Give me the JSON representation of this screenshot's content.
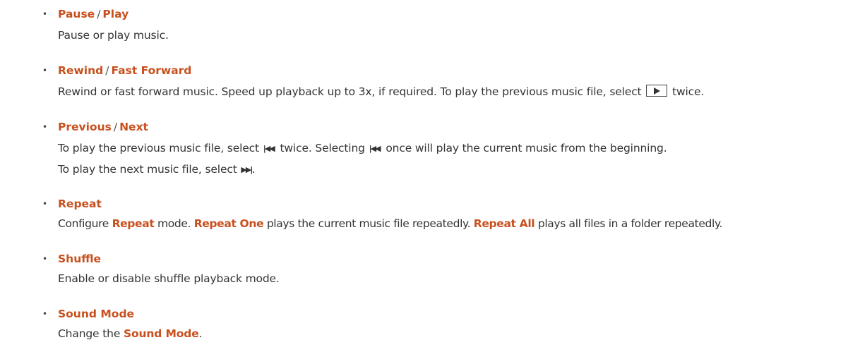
{
  "items": [
    {
      "bullet": "•",
      "title_a": "Pause",
      "sep": "/",
      "title_b": "Play",
      "desc": "Pause or play music."
    },
    {
      "bullet": "•",
      "title_a": "Rewind",
      "sep": "/",
      "title_b": "Fast Forward",
      "desc_pre": "Rewind or fast forward music. Speed up playback up to 3x, if required. To play the previous music file, select",
      "desc_icon": "play-box-icon",
      "desc_post": "twice."
    },
    {
      "bullet": "•",
      "title_a": "Previous",
      "sep": "/",
      "title_b": "Next",
      "line1_pre": "To play the previous music file, select",
      "line1_icon": "skip-previous-icon",
      "line1_mid": "twice. Selecting",
      "line1_icon2": "skip-previous-icon",
      "line1_post": "once will play the current music from the beginning.",
      "line2_pre": "To play the next music file, select",
      "line2_icon": "skip-next-icon",
      "line2_post": "."
    },
    {
      "bullet": "•",
      "title": "Repeat",
      "desc_p1": "Configure",
      "desc_kw1": "Repeat",
      "desc_p2": "mode.",
      "desc_kw2": "Repeat One",
      "desc_p3": "plays the current music file repeatedly.",
      "desc_kw3": "Repeat All",
      "desc_p4": "plays all files in a folder repeatedly."
    },
    {
      "bullet": "•",
      "title": "Shuffle",
      "desc": "Enable or disable shuffle playback mode."
    },
    {
      "bullet": "•",
      "title": "Sound Mode",
      "desc_p1": "Change the",
      "desc_kw1": "Sound Mode",
      "desc_p2": "."
    }
  ],
  "colors": {
    "keyword": "#c8501e",
    "text": "#333333"
  }
}
